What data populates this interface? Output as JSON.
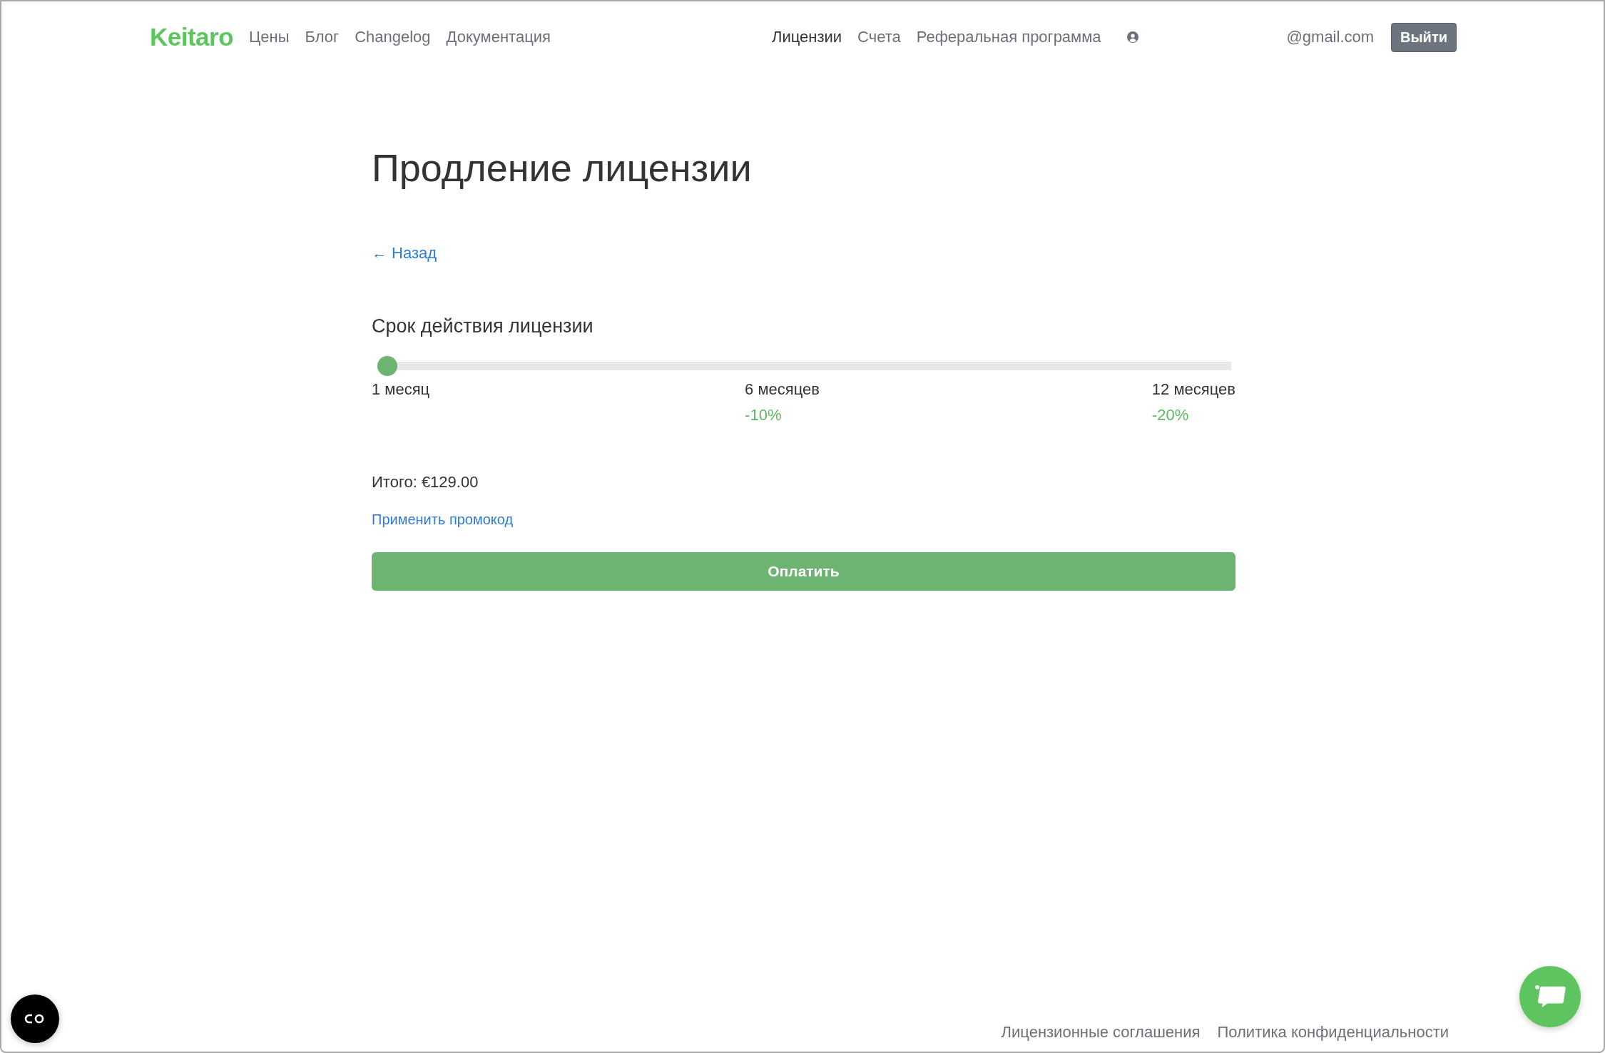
{
  "header": {
    "logo": "Keitaro",
    "nav_left": [
      {
        "label": "Цены",
        "selected": false
      },
      {
        "label": "Блог",
        "selected": false
      },
      {
        "label": "Changelog",
        "selected": false
      },
      {
        "label": "Документация",
        "selected": false
      }
    ],
    "nav_right": [
      {
        "label": "Лицензии",
        "selected": true
      },
      {
        "label": "Счета",
        "selected": false
      },
      {
        "label": "Реферальная программа",
        "selected": false
      }
    ],
    "email": "@gmail.com",
    "logout": "Выйти"
  },
  "page": {
    "title": "Продление лицензии",
    "back_link": "← Назад",
    "section_title": "Срок действия лицензии",
    "slider": {
      "level": 0,
      "stops": [
        {
          "label": "1 месяц"
        },
        {
          "label": "6 месяцев",
          "discount": "-10%"
        },
        {
          "label": "12 месяцев",
          "discount": "-20%"
        }
      ]
    },
    "total": "Итого: €129.00",
    "promo_link": "Применить промокод",
    "pay_button": "Оплатить"
  },
  "footer": {
    "links": [
      "Лицензионные соглашения",
      "Политика конфиденциальности"
    ]
  }
}
